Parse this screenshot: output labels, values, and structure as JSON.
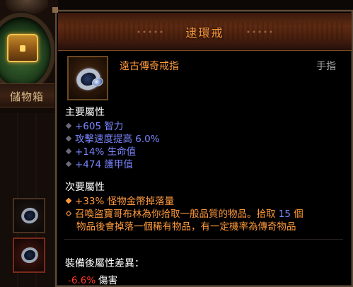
{
  "stash": {
    "label": "儲物箱"
  },
  "tooltip": {
    "item_name": "逮環戒",
    "item_type": "遠古傳奇戒指",
    "item_slot": "手指",
    "primary_header": "主要屬性",
    "primary_stats": [
      "+605 智力",
      "攻擊速度提高 6.0%",
      "+14% 生命值",
      "+474 護甲值"
    ],
    "secondary_header": "次要屬性",
    "secondary_stats": {
      "s1": "+33% 怪物金幣掉落量",
      "s2_line1_a": "召喚盜寶哥布林為你拾取一般品質的物品。拾取",
      "s2_num": "15",
      "s2_line1_b": "個",
      "s2_line2": "物品後會掉落一個稀有物品，有一定機率為傳奇物品"
    },
    "diff_header": "裝備後屬性差異：",
    "diff_value": "-6.6%",
    "diff_label": "傷害"
  },
  "colors": {
    "legendary_orange": "#ff9a3c",
    "magic_blue": "#7a86ff",
    "negative_red": "#ff3a2a"
  },
  "icons": [
    "ring-item-icon",
    "treasure-chest-icon",
    "ring-slot-icon"
  ]
}
